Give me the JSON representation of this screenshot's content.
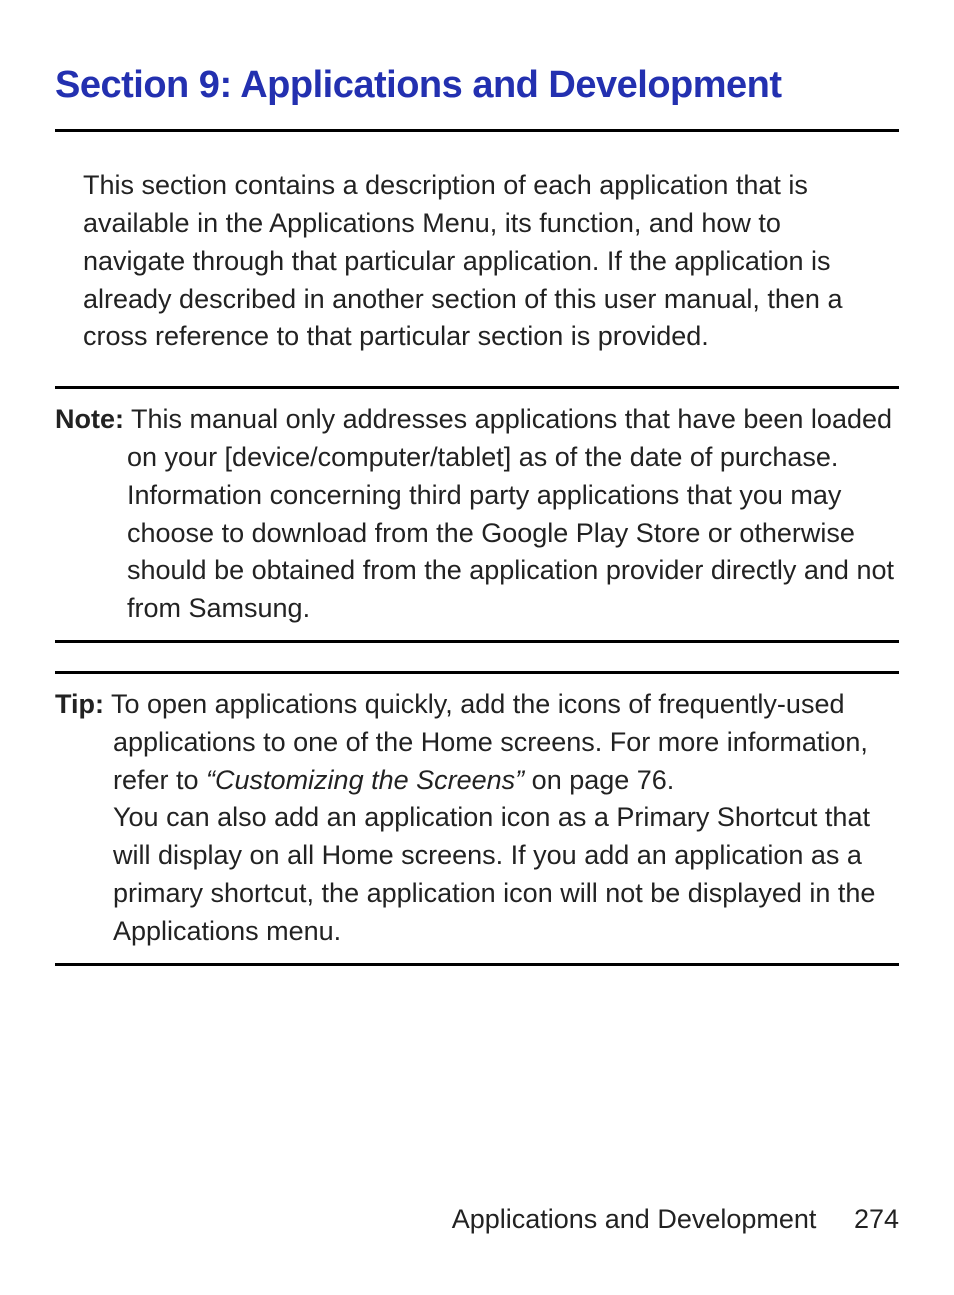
{
  "header": {
    "title": "Section 9: Applications and Development"
  },
  "intro": {
    "text": "This section contains a description of each application that is available in the Applications Menu, its function, and how to navigate through that particular application. If the application is already described in another section of this user manual, then a cross reference to that particular section is provided."
  },
  "note": {
    "label": "Note:",
    "body": "This manual only addresses applications that have been loaded on your [device/computer/tablet] as of the date of purchase. Information concerning third party applications that you may choose to download from the Google Play Store or otherwise should be obtained from the application provider directly and not from Samsung."
  },
  "tip": {
    "label": "Tip:",
    "body_part1": "To open applications quickly, add the icons of frequently-used applications to one of the Home screens. For more information, refer to ",
    "ref": "“Customizing the Screens”",
    "body_part2": " on page 76.",
    "body_part3": "You can also add an application icon as a Primary Shortcut that will display on all Home screens. If you add an application as a primary shortcut, the application icon will not be displayed in the Applications menu."
  },
  "footer": {
    "section": "Applications and Development",
    "page": "274"
  }
}
